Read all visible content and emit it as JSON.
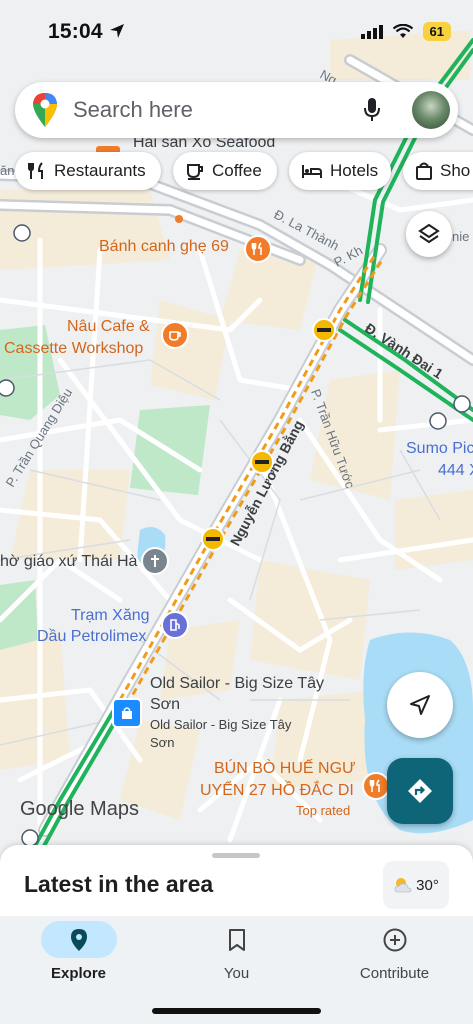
{
  "status_bar": {
    "time": "15:04",
    "battery": "61"
  },
  "search": {
    "placeholder": "Search here"
  },
  "chips": [
    {
      "label": "Restaurants",
      "icon": "fork-knife-icon"
    },
    {
      "label": "Coffee",
      "icon": "coffee-cup-icon"
    },
    {
      "label": "Hotels",
      "icon": "bed-icon"
    },
    {
      "label": "Sho",
      "icon": "shopping-bag-icon"
    }
  ],
  "map": {
    "labels": {
      "hai_san": "Hải sản Xô Seafood",
      "banh_canh": "Bánh canh ghẹ 69",
      "nau_cafe_1": "Nâu Cafe &",
      "nau_cafe_2": "Cassette Workshop",
      "giao_xu": "hờ giáo xứ Thái Hà",
      "tram_xang_1": "Trạm Xăng",
      "tram_xang_2": "Dầu Petrolimex",
      "old_sailor_1": "Old Sailor - Big Size Tây",
      "old_sailor_2": "Sơn",
      "old_sailor_sub_1": "Old Sailor - Big Size Tây",
      "old_sailor_sub_2": "Sơn",
      "bun_bo_1": "BÚN BÒ HUẾ NGƯ",
      "bun_bo_2": "UYỂN 27 HỒ ĐẮC DI",
      "bun_bo_tag": "Top rated",
      "sumo_1": "Sumo Pic",
      "sumo_2": "444 X"
    },
    "streets": {
      "la_thanh": "Đ. La Thành",
      "vanh_dai": "Đ. Vành Đai 1",
      "nguyen_luong_bang": "Nguyễn Lương Bằng",
      "tran_huu_tuoc": "P. Trần Hữu Tước",
      "tran_quang_dieu": "P. Trần Quang Diệu",
      "p_kh": "P. Kh",
      "nie": "nie",
      "ng": "Ng",
      "an": "ăn"
    },
    "logo": "Google Maps"
  },
  "colors": {
    "traffic_green": "#1fb35b",
    "traffic_orange": "#f29b1a",
    "direction_button": "#0d6577",
    "poi_orange": "#d4661c",
    "poi_blue": "#4a6fd2",
    "water": "#a9dcf6",
    "park": "#bfe8c8"
  },
  "sheet": {
    "title": "Latest in the area",
    "temperature": "30°"
  },
  "nav": [
    {
      "label": "Explore",
      "icon": "explore-pin-icon",
      "active": true
    },
    {
      "label": "You",
      "icon": "bookmark-icon",
      "active": false
    },
    {
      "label": "Contribute",
      "icon": "add-circle-icon",
      "active": false
    }
  ]
}
